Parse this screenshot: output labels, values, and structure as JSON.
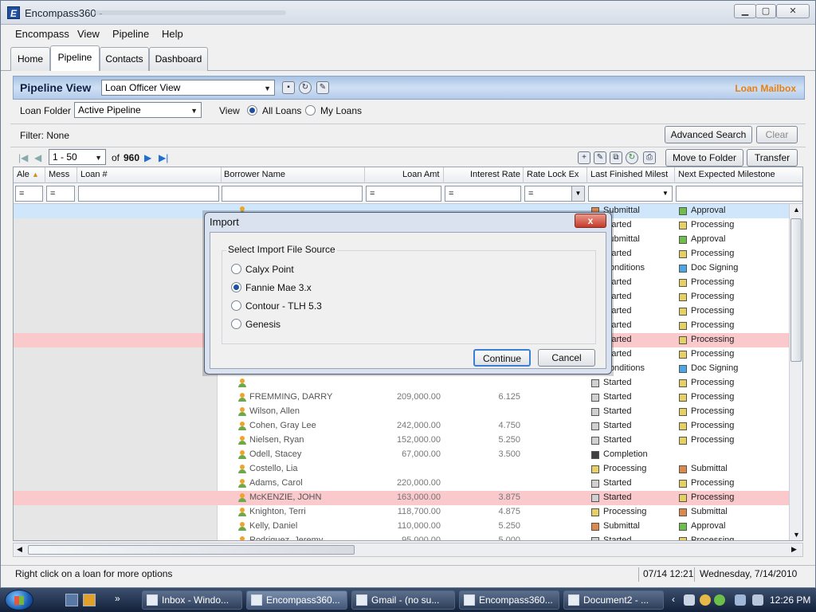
{
  "window": {
    "title": "Encompass360 - "
  },
  "menu": [
    "Encompass",
    "View",
    "Pipeline",
    "Help"
  ],
  "tabs": [
    "Home",
    "Pipeline",
    "Contacts",
    "Dashboard"
  ],
  "pipeline_view": {
    "title": "Pipeline View",
    "view_select": "Loan Officer View",
    "mailbox": "Loan Mailbox",
    "loan_folder_label": "Loan Folder",
    "loan_folder_value": "Active Pipeline",
    "view_label": "View",
    "all_loans": "All Loans",
    "my_loans": "My Loans",
    "filter_text": "Filter:  None",
    "advanced_search": "Advanced Search",
    "clear": "Clear",
    "page_range": "1 - 50",
    "of_label": "of",
    "total": "960",
    "move_to_folder": "Move to Folder",
    "transfer": "Transfer"
  },
  "columns": [
    "Ale",
    "Mess",
    "Loan #",
    "Borrower Name",
    "Loan Amt",
    "Interest Rate",
    "Rate Lock Ex",
    "Last Finished Milest",
    "Next Expected Milestone"
  ],
  "filters": {
    "f1": "=",
    "f2": "=",
    "f5": "=",
    "f6": "=",
    "f7": "="
  },
  "colors": {
    "yellow": "#e8d060",
    "green": "#6cc04a",
    "blue": "#4aa8e8",
    "orange": "#e0884a",
    "gray": "#d0d0d0",
    "dark": "#404040"
  },
  "rows": [
    {
      "last": "Submittal",
      "last_c": "orange",
      "next": "Approval",
      "next_c": "green",
      "style": "sel"
    },
    {
      "last": "Started",
      "last_c": "gray",
      "next": "Processing",
      "next_c": "yellow"
    },
    {
      "last": "Submittal",
      "last_c": "orange",
      "next": "Approval",
      "next_c": "green"
    },
    {
      "last": "Started",
      "last_c": "gray",
      "next": "Processing",
      "next_c": "yellow"
    },
    {
      "last": "Conditions",
      "last_c": "gray",
      "next": "Doc Signing",
      "next_c": "blue"
    },
    {
      "last": "Started",
      "last_c": "gray",
      "next": "Processing",
      "next_c": "yellow"
    },
    {
      "last": "Started",
      "last_c": "gray",
      "next": "Processing",
      "next_c": "yellow"
    },
    {
      "last": "Started",
      "last_c": "gray",
      "next": "Processing",
      "next_c": "yellow"
    },
    {
      "last": "Started",
      "last_c": "gray",
      "next": "Processing",
      "next_c": "yellow"
    },
    {
      "last": "Started",
      "last_c": "gray",
      "next": "Processing",
      "next_c": "yellow",
      "style": "pink"
    },
    {
      "last": "Started",
      "last_c": "gray",
      "next": "Processing",
      "next_c": "yellow"
    },
    {
      "last": "Conditions",
      "last_c": "gray",
      "next": "Doc Signing",
      "next_c": "blue"
    },
    {
      "last": "Started",
      "last_c": "gray",
      "next": "Processing",
      "next_c": "yellow"
    },
    {
      "borrower": "FREMMING, DARRY",
      "amt": "209,000.00",
      "rate": "6.125",
      "last": "Started",
      "last_c": "gray",
      "next": "Processing",
      "next_c": "yellow"
    },
    {
      "borrower": "Wilson, Allen",
      "last": "Started",
      "last_c": "gray",
      "next": "Processing",
      "next_c": "yellow"
    },
    {
      "borrower": "Cohen, Gray Lee",
      "amt": "242,000.00",
      "rate": "4.750",
      "last": "Started",
      "last_c": "gray",
      "next": "Processing",
      "next_c": "yellow"
    },
    {
      "borrower": "Nielsen, Ryan",
      "amt": "152,000.00",
      "rate": "5.250",
      "last": "Started",
      "last_c": "gray",
      "next": "Processing",
      "next_c": "yellow"
    },
    {
      "borrower": "Odell, Stacey",
      "amt": "67,000.00",
      "rate": "3.500",
      "last": "Completion",
      "last_c": "dark",
      "next": ""
    },
    {
      "borrower": "Costello, Lia",
      "last": "Processing",
      "last_c": "yellow",
      "next": "Submittal",
      "next_c": "orange"
    },
    {
      "borrower": "Adams, Carol",
      "amt": "220,000.00",
      "last": "Started",
      "last_c": "gray",
      "next": "Processing",
      "next_c": "yellow"
    },
    {
      "borrower": "McKENZIE, JOHN",
      "amt": "163,000.00",
      "rate": "3.875",
      "last": "Started",
      "last_c": "gray",
      "next": "Processing",
      "next_c": "yellow",
      "style": "pink"
    },
    {
      "borrower": "Knighton, Terri",
      "amt": "118,700.00",
      "rate": "4.875",
      "last": "Processing",
      "last_c": "yellow",
      "next": "Submittal",
      "next_c": "orange"
    },
    {
      "borrower": "Kelly, Daniel",
      "amt": "110,000.00",
      "rate": "5.250",
      "last": "Submittal",
      "last_c": "orange",
      "next": "Approval",
      "next_c": "green"
    },
    {
      "borrower": "Rodriguez, Jeremy",
      "amt": "95,000.00",
      "rate": "5.000",
      "last": "Started",
      "last_c": "gray",
      "next": "Processing",
      "next_c": "yellow"
    }
  ],
  "status": {
    "hint": "Right click on a loan for more options",
    "time": "07/14 12:21",
    "date": "Wednesday, 7/14/2010"
  },
  "modal": {
    "title": "Import",
    "close": "x",
    "group_label": "Select Import File Source",
    "options": [
      "Calyx Point",
      "Fannie Mae 3.x",
      "Contour - TLH 5.3",
      "Genesis"
    ],
    "selected_index": 1,
    "continue": "Continue",
    "cancel": "Cancel"
  },
  "taskbar": {
    "items": [
      {
        "label": "Inbox - Windo...",
        "icon": "mail-icon"
      },
      {
        "label": "Encompass360...",
        "icon": "encompass-icon",
        "active": true
      },
      {
        "label": "Gmail - (no su...",
        "icon": "browser-icon"
      },
      {
        "label": "Encompass360...",
        "icon": "word-doc-icon"
      },
      {
        "label": "Document2 - ...",
        "icon": "word-doc-icon"
      }
    ],
    "clock": "12:26 PM"
  }
}
